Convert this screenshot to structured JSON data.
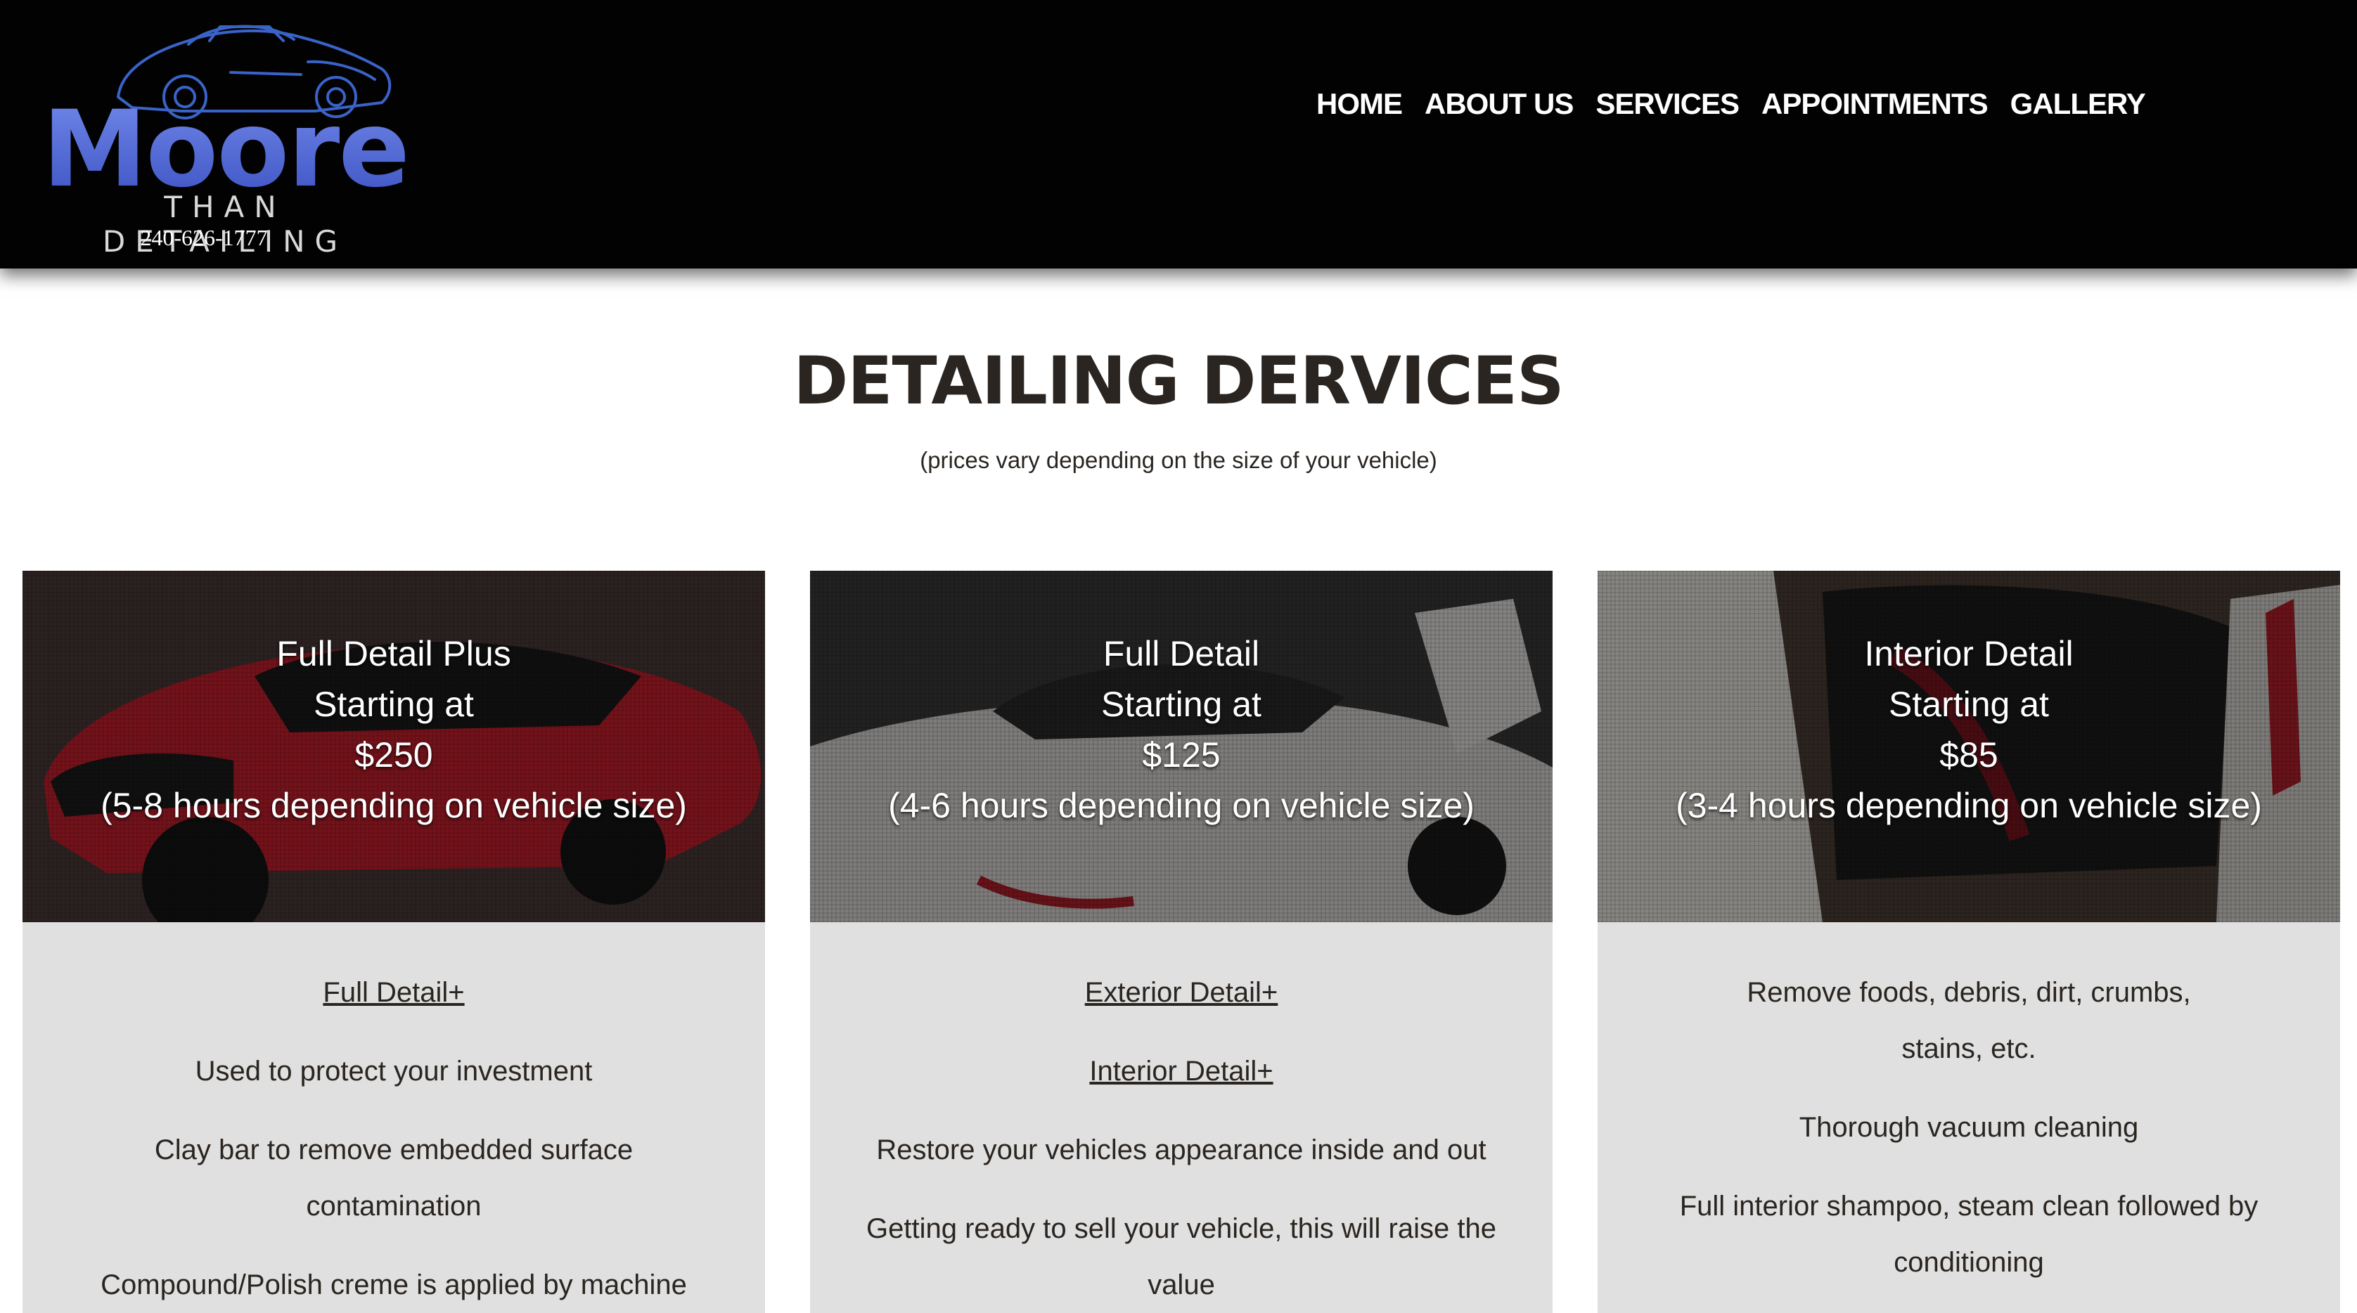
{
  "header": {
    "brand": "Moore",
    "tagline": "THAN DETAILING",
    "phone": "240-626-1777",
    "nav": [
      "HOME",
      "ABOUT US",
      "SERVICES",
      "APPOINTMENTS",
      "GALLERY"
    ]
  },
  "main": {
    "title": "DETAILING DERVICES",
    "subtitle": "(prices vary depending on the size of your vehicle)"
  },
  "cards": [
    {
      "lines": [
        "Full Detail Plus",
        "Starting at",
        "$250",
        "(5-8 hours depending on vehicle size)"
      ],
      "body": [
        "Full Detail+",
        "Used to protect your investment",
        "Clay bar to remove embedded surface contamination",
        "Compound/Polish creme is applied by machine"
      ]
    },
    {
      "lines": [
        "Full Detail",
        "Starting at",
        "$125",
        "(4-6 hours depending on vehicle size)"
      ],
      "body": [
        "Exterior Detail+",
        "Interior Detail+",
        "Restore your vehicles appearance inside and out",
        "Getting ready to sell your vehicle, this will raise the value"
      ]
    },
    {
      "lines": [
        "Interior Detail",
        "Starting at",
        "$85",
        "(3-4 hours depending on vehicle size)"
      ],
      "body": [
        "Remove foods, debris, dirt, crumbs, stains, etc.",
        "Thorough vacuum cleaning",
        "Full interior shampoo, steam clean followed by conditioning"
      ]
    }
  ],
  "colors": {
    "header_bg": "#020202",
    "brand_blue": "#4a6fd1",
    "text_dark": "#2a2520",
    "card_bg": "#e0e0e0",
    "car_red": "#c8202e"
  },
  "icons": [
    "car-logo-icon"
  ]
}
